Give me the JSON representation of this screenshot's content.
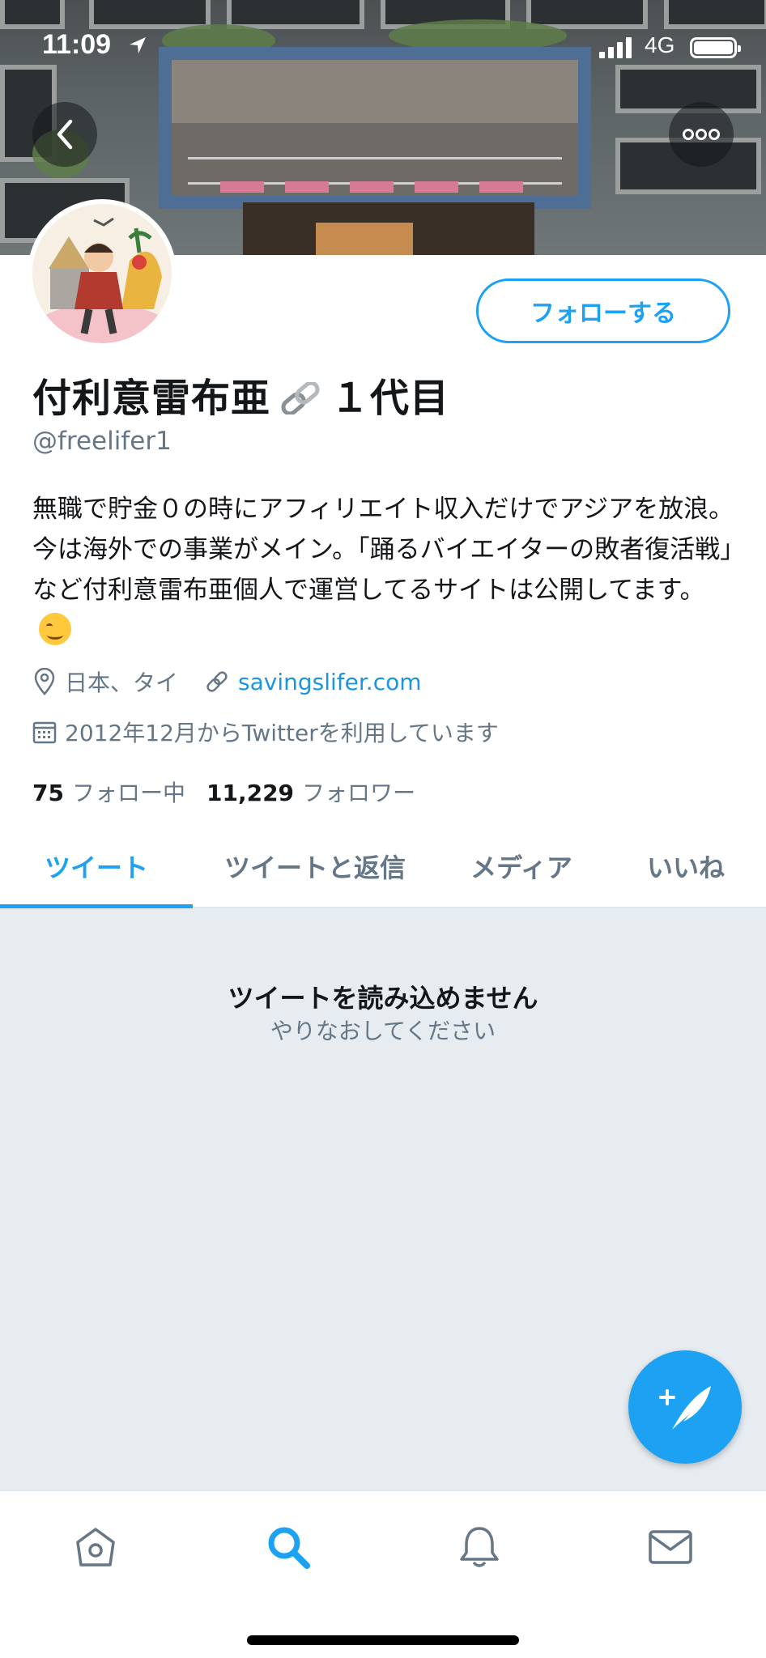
{
  "status_bar": {
    "time": "11:09",
    "network": "4G"
  },
  "header": {
    "back_icon": "chevron-left-icon",
    "more_icon": "more-dots-icon"
  },
  "profile": {
    "display_name_part1": "付利意雷布亜",
    "display_name_part2": "１代目",
    "name_emoji": "link-icon",
    "handle": "@freelifer1",
    "follow_button_label": "フォローする",
    "bio": "無職で貯金０の時にアフィリエイト収入だけでアジアを放浪。今は海外での事業がメイン。「踊るバイエイターの敗者復活戦」など付利意雷布亜個人で運営してるサイトは公開してます。",
    "bio_emoji": "smiling-face-icon",
    "location": "日本、タイ",
    "website": "savingslifer.com",
    "joined": "2012年12月からTwitterを利用しています",
    "following_count": "75",
    "following_label": "フォロー中",
    "followers_count": "11,229",
    "followers_label": "フォロワー"
  },
  "tabs": [
    {
      "label": "ツイート",
      "active": true
    },
    {
      "label": "ツイートと返信",
      "active": false
    },
    {
      "label": "メディア",
      "active": false
    },
    {
      "label": "いいね",
      "active": false
    }
  ],
  "feed": {
    "error_title": "ツイートを読み込めません",
    "error_subtitle": "やりなおしてください"
  },
  "compose_icon": "compose-tweet-icon",
  "bottom_nav": [
    "home-icon",
    "search-icon",
    "bell-icon",
    "mail-icon"
  ],
  "colors": {
    "accent": "#1da1f2",
    "link": "#1b95e0",
    "secondary_text": "#657786",
    "feed_background": "#e6ecf0"
  }
}
